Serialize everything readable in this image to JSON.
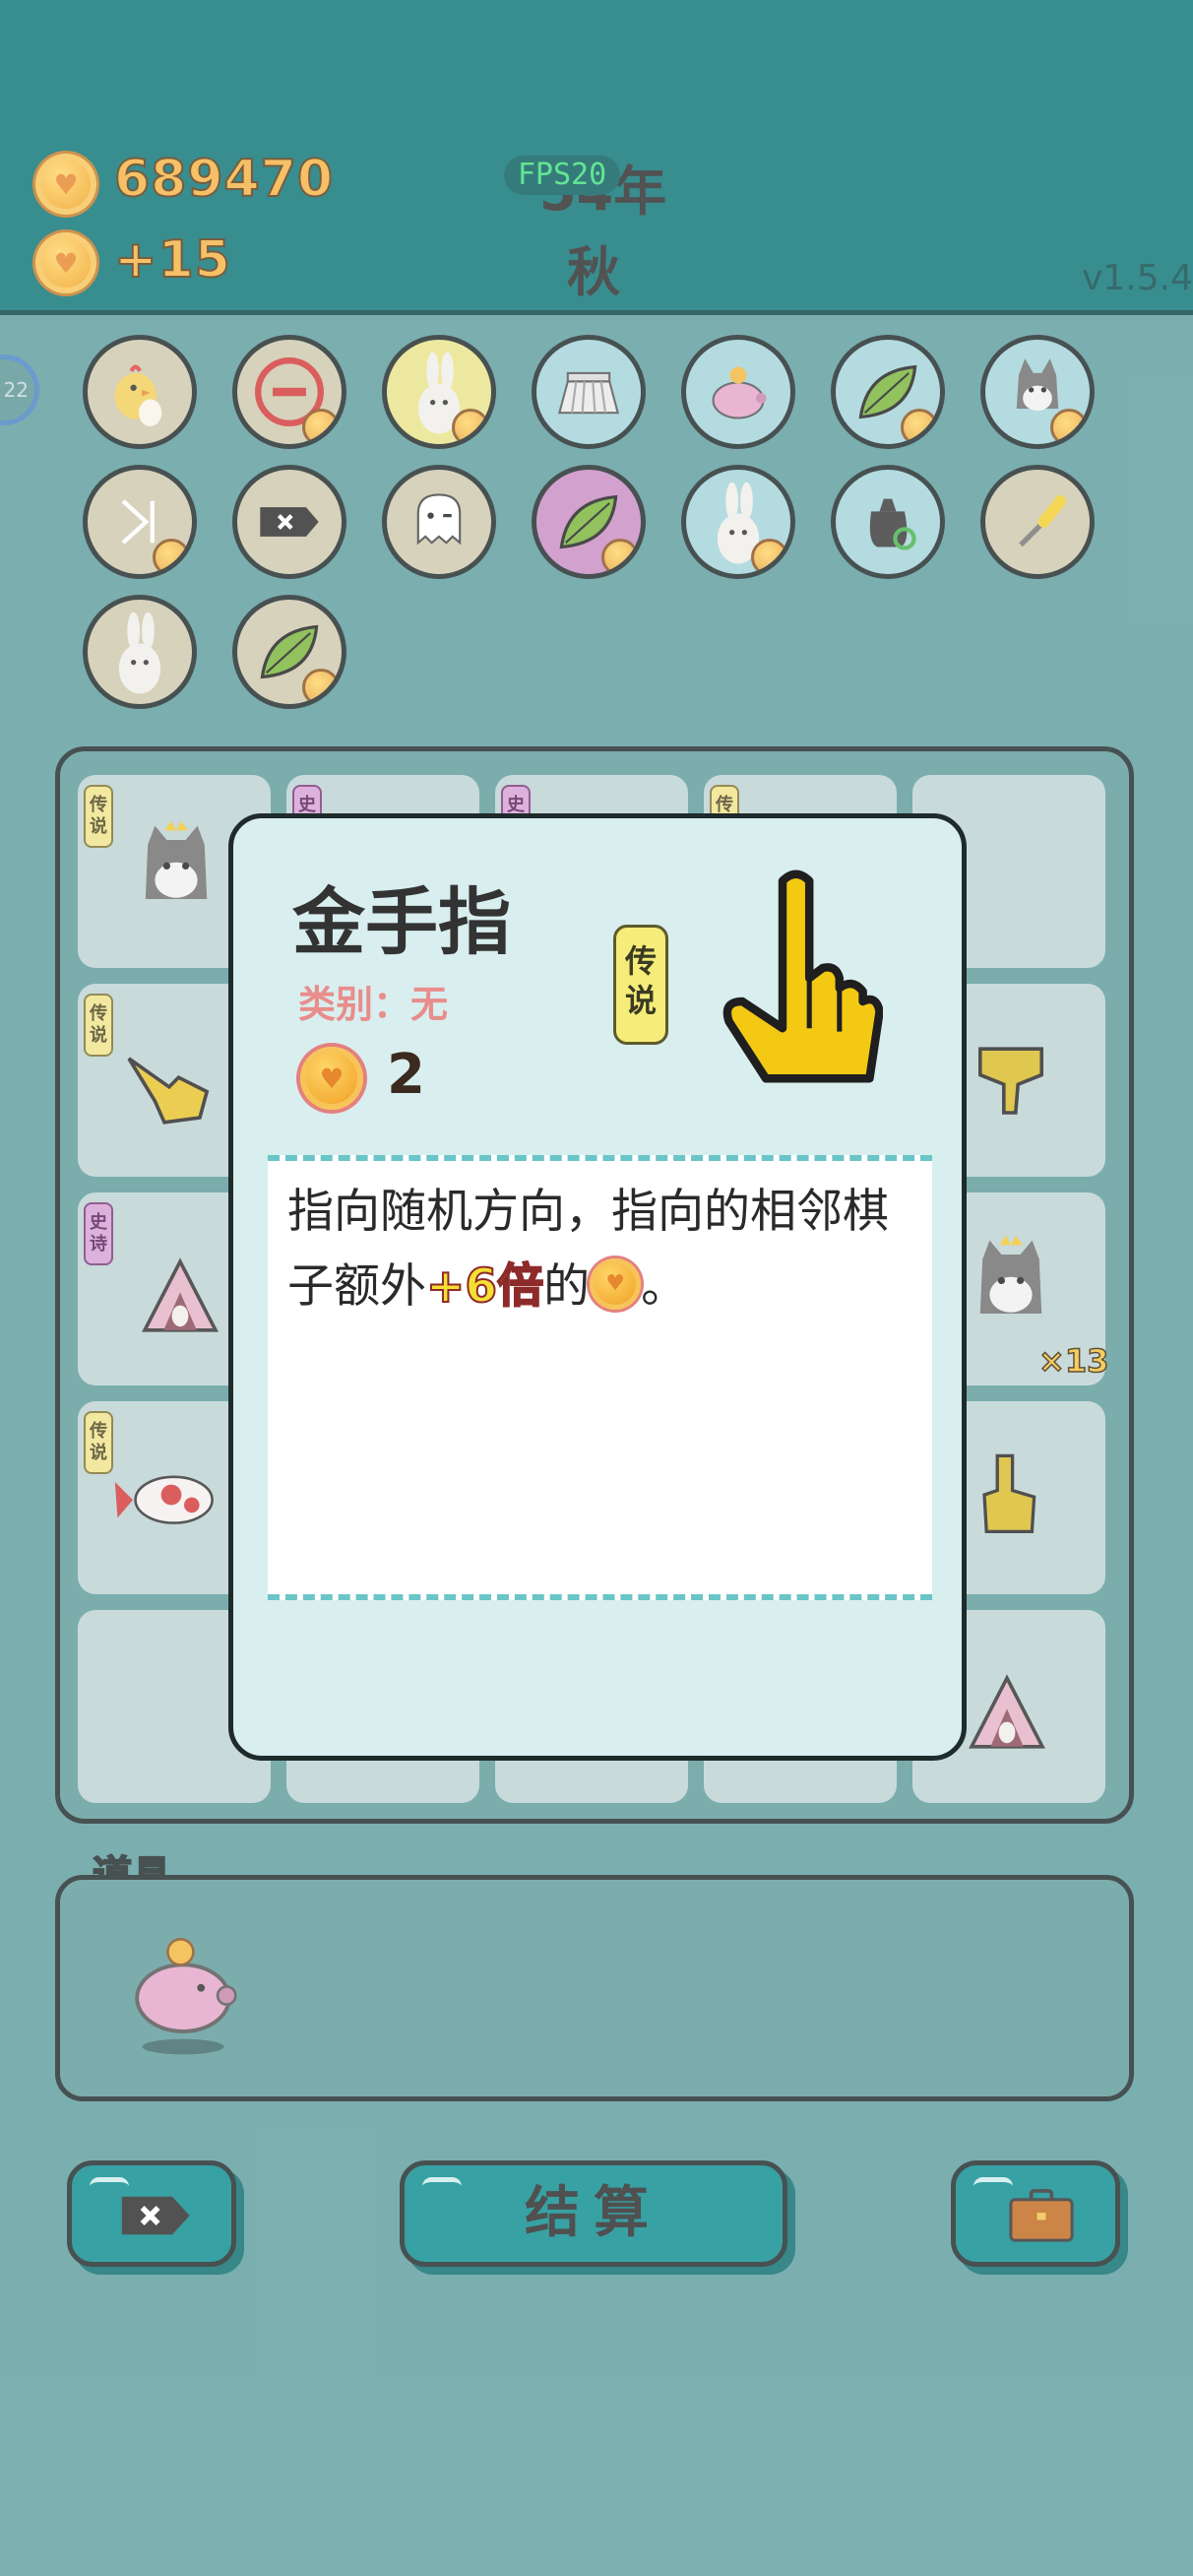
{
  "header": {
    "coins": "689470",
    "income": "+15",
    "year": "54年",
    "season": "秋",
    "fps": "FPS20",
    "version": "v1.5.4",
    "side_badge": "22"
  },
  "owned_items": [
    "chick-egg",
    "no-entry",
    "rabbit",
    "skirt",
    "piggy-bank",
    "leaf",
    "husky",
    "skip-next",
    "remove-tag",
    "ghost",
    "leaf",
    "rabbit",
    "recycle-bag",
    "screwdriver",
    "rabbit",
    "leaf"
  ],
  "board": {
    "tags": {
      "legend": "传说",
      "epic": "史诗"
    },
    "cell_counter": "×13"
  },
  "tools": {
    "label": "道具",
    "items": [
      "piggy-bank"
    ]
  },
  "buttons": {
    "remove_icon": "remove-tag-icon",
    "settle_label": "结算",
    "bag_icon": "briefcase-icon"
  },
  "popup": {
    "title": "金手指",
    "category": "类别：无",
    "rarity": "传说",
    "count": "2",
    "desc_part1": "指向随机方向，指向的相邻棋子额外",
    "desc_highlight": "+6倍",
    "desc_part2": "的",
    "desc_part3": "。",
    "icon": "pointing-finger-icon"
  },
  "colors": {
    "header_bg": "#0d7577",
    "page_bg": "#5f9d9e",
    "accent_button": "#0d8d8f",
    "coin_gold": "#f4b245",
    "legend_tag": "#f5ec7a"
  }
}
